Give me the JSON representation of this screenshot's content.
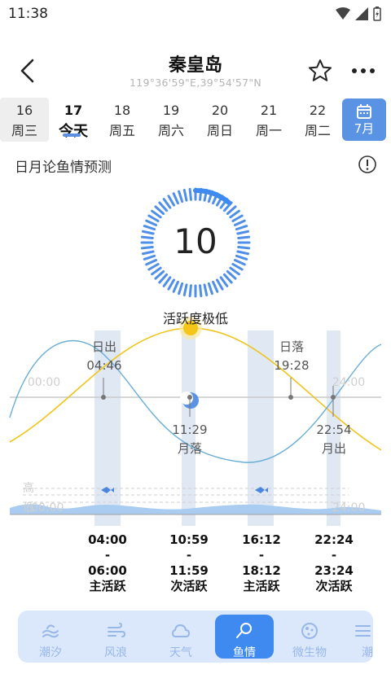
{
  "status": {
    "time": "11:38"
  },
  "header": {
    "title": "秦皇岛",
    "coords": "119°36'59\"E,39°54'57\"N"
  },
  "dates": [
    {
      "day": "16",
      "weekday": "周三"
    },
    {
      "day": "17",
      "weekday": "今天"
    },
    {
      "day": "18",
      "weekday": "周五"
    },
    {
      "day": "19",
      "weekday": "周六"
    },
    {
      "day": "20",
      "weekday": "周日"
    },
    {
      "day": "21",
      "weekday": "周一"
    },
    {
      "day": "22",
      "weekday": "周二"
    }
  ],
  "month_button": "7月",
  "section_title": "日月论鱼情预测",
  "gauge": {
    "value": "10",
    "label": "活跃度极低",
    "fraction": 0.1
  },
  "chart": {
    "axis_start": "00:00",
    "axis_end": "24:00",
    "sunrise": {
      "label": "日出",
      "time": "04:46"
    },
    "sunset": {
      "label": "日落",
      "time": "19:28"
    },
    "moonset": {
      "label": "月落",
      "time": "11:29"
    },
    "moonrise": {
      "label": "月出",
      "time": "22:54"
    },
    "tide_high": "高",
    "tide_low": "低",
    "tide_start": "00:00",
    "tide_end": "24:00"
  },
  "windows": [
    {
      "start": "04:00",
      "sep": "-",
      "end": "06:00",
      "type": "主活跃"
    },
    {
      "start": "10:59",
      "sep": "-",
      "end": "11:59",
      "type": "次活跃"
    },
    {
      "start": "16:12",
      "sep": "-",
      "end": "18:12",
      "type": "主活跃"
    },
    {
      "start": "22:24",
      "sep": "-",
      "end": "23:24",
      "type": "次活跃"
    }
  ],
  "tabs": [
    {
      "label": "潮汐",
      "icon": "tide-icon"
    },
    {
      "label": "风浪",
      "icon": "wind-icon"
    },
    {
      "label": "天气",
      "icon": "cloud-icon"
    },
    {
      "label": "鱼情",
      "icon": "fish-hook-icon"
    },
    {
      "label": "微生物",
      "icon": "microbe-icon"
    },
    {
      "label": "潮",
      "icon": "more-tab-icon"
    }
  ],
  "colors": {
    "accent": "#3e8af0",
    "sun_curve": "#f0c419",
    "moon_curve": "#6aaed6"
  }
}
